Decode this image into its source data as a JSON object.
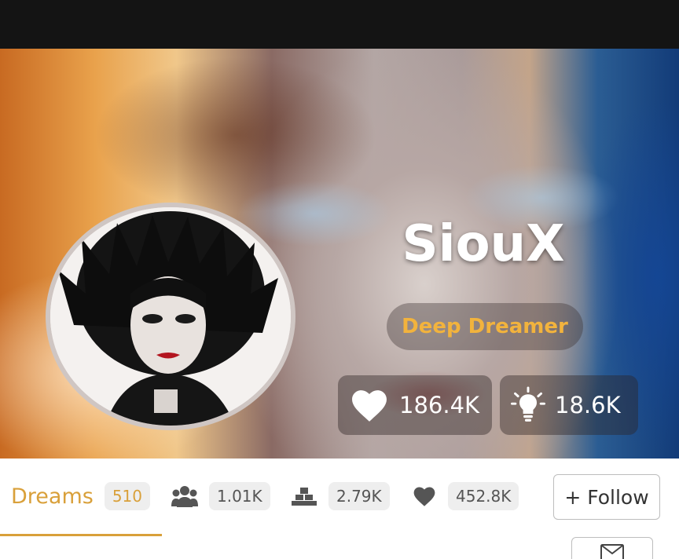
{
  "profile": {
    "name": "SiouX",
    "rank": "Deep Dreamer",
    "likes_received": "186.4K",
    "ideas": "18.6K"
  },
  "tabs": {
    "dreams_label": "Dreams",
    "dreams_count": "510"
  },
  "meta": {
    "followers": "1.01K",
    "ranking": "2.79K",
    "likes": "452.8K"
  },
  "actions": {
    "follow_label": "+ Follow"
  },
  "colors": {
    "accent": "#d9a03a",
    "rank_text": "#f2b33d",
    "top_bar": "#141414"
  },
  "icons": [
    "heart-icon",
    "lightbulb-icon",
    "followers-icon",
    "ranking-icon",
    "heart-icon",
    "envelope-icon"
  ]
}
